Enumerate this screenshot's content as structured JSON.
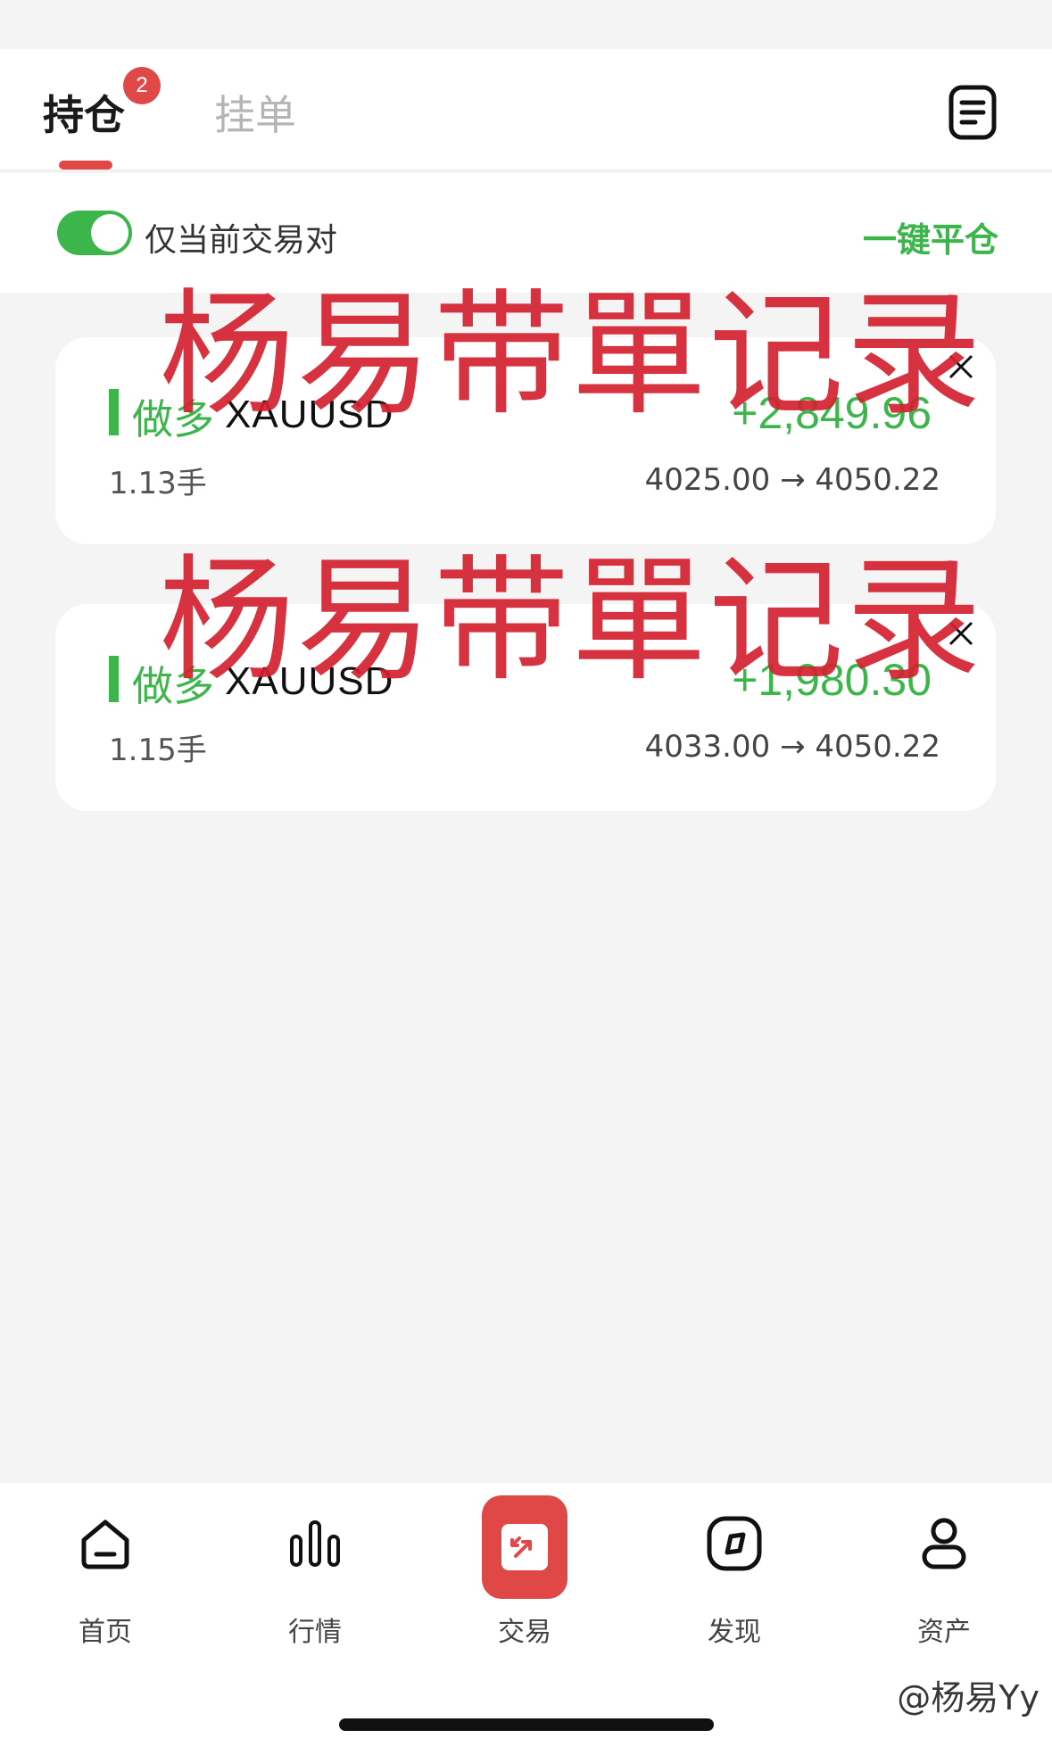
{
  "tabs": {
    "positions_label": "持仓",
    "positions_badge": "2",
    "orders_label": "挂单"
  },
  "filter": {
    "current_pair_only_label": "仅当前交易对",
    "toggle_on": true,
    "close_all_label": "一键平仓"
  },
  "positions": [
    {
      "direction": "做多",
      "symbol": "XAUUSD",
      "pnl": "+2,849.96",
      "lots": "1.13手",
      "entry": "4025.00",
      "arrow": "→",
      "current": "4050.22"
    },
    {
      "direction": "做多",
      "symbol": "XAUUSD",
      "pnl": "+1,980.30",
      "lots": "1.15手",
      "entry": "4033.00",
      "arrow": "→",
      "current": "4050.22"
    }
  ],
  "overlay_text": "杨易带單记录",
  "nav": {
    "home": "首页",
    "market": "行情",
    "trade": "交易",
    "discover": "发现",
    "assets": "资产"
  },
  "credit": "@杨易Yy",
  "colors": {
    "accent_red": "#e04848",
    "profit_green": "#3cb54a",
    "overlay_red": "#d3212f"
  }
}
